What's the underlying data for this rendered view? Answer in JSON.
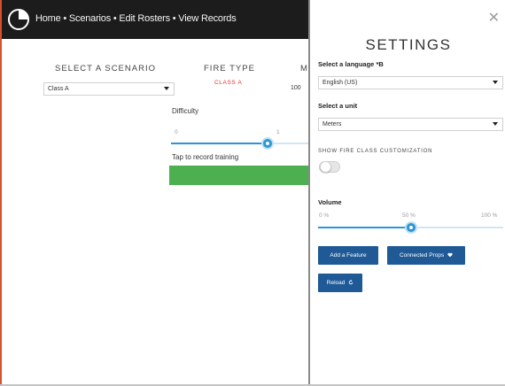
{
  "topbar": {
    "breadcrumb": "Home • Scenarios • Edit Rosters • View Records"
  },
  "main": {
    "scenario_heading": "SELECT A SCENARIO",
    "scenario_value": "Class A",
    "fire_type_heading": "FIRE TYPE",
    "fire_type_value": "CLASS A",
    "third_heading": "M",
    "third_value": "100",
    "difficulty_label": "Difficulty",
    "difficulty_min": "0",
    "difficulty_max": "1",
    "difficulty_level": 0.7,
    "record_label": "Tap to record training",
    "record_toggle_on": false
  },
  "settings": {
    "title": "SETTINGS",
    "close_glyph": "✕",
    "language_label": "Select a language *B",
    "language_value": "English (US)",
    "unit_label": "Select a unit",
    "unit_value": "Meters",
    "fire_class_label": "SHOW FIRE CLASS CUSTOMIZATION",
    "fire_class_toggle_on": false,
    "volume_label": "Volume",
    "volume_min": "0 %",
    "volume_mid": "50 %",
    "volume_max": "100 %",
    "volume_level": 0.5,
    "add_feature_button": "Add a Feature",
    "connected_button": "Connected Props",
    "reload_button": "Reload"
  },
  "colors": {
    "accent": "#2b95d6",
    "button": "#1f5a96",
    "start_bar": "#4caf50",
    "fire_type": "#e03030",
    "topbar": "#1c1c1c"
  },
  "icons": [
    "logo-icon",
    "chevron-down-icon",
    "close-icon",
    "heart-icon",
    "refresh-icon"
  ]
}
